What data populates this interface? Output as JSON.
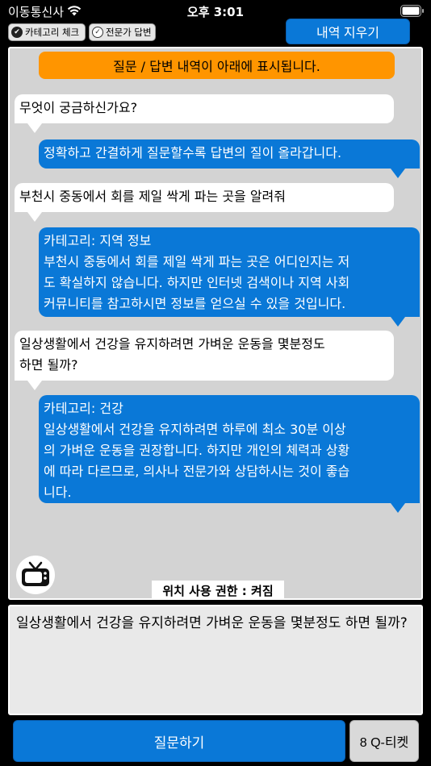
{
  "status_bar": {
    "carrier": "이동통신사",
    "time": "오후 3:01",
    "icons": [
      "wifi-icon",
      "battery-icon"
    ]
  },
  "toggles": {
    "category_check": {
      "label": "카테고리 체크",
      "checked": true
    },
    "expert_answer": {
      "label": "전문가 답변",
      "checked": false
    }
  },
  "clear_button": {
    "label": "내역 지우기"
  },
  "chat": {
    "banner": "질문 / 답변 내역이 아래에 표시됩니다.",
    "messages": [
      {
        "role": "user",
        "lines": [
          "무엇이 궁금하신가요?"
        ]
      },
      {
        "role": "bot",
        "lines": [
          "정확하고 간결하게 질문할수록 답변의 질이 올라갑니다."
        ]
      },
      {
        "role": "user",
        "lines": [
          "부천시 중동에서 회를 제일 싹게 파는 곳을 알려줘"
        ]
      },
      {
        "role": "bot",
        "lines": [
          "카테고리: 지역 정보",
          "부천시 중동에서 회를 제일 싹게 파는 곳은 어디인지는 저",
          "도 확실하지 않습니다. 하지만 인터넷 검색이나 지역 사회",
          "커뮤니티를 참고하시면 정보를 얻으실 수 있을 것입니다."
        ]
      },
      {
        "role": "user",
        "lines": [
          "일상생활에서 건강을 유지하려면 가벼운 운동을 몇분정도",
          "하면 될까?"
        ]
      },
      {
        "role": "bot",
        "lines": [
          "카테고리: 건강",
          "일상생활에서 건강을 유지하려면 하루에 최소 30분 이상",
          "의 가벼운 운동을 권장합니다. 하지만 개인의 체력과 상황",
          "에 따라 다르므로, 의사나 전문가와 상담하시는 것이 좋습",
          "니다."
        ]
      }
    ],
    "location_permission": "위치 사용 권한 : 켜짐",
    "avatar_icon": "tv-icon"
  },
  "input": {
    "value": "일상생활에서 건강을 유지하려면 가벼운 운동을 몇분정도 하면 될까?"
  },
  "ask_button": {
    "label": "질문하기"
  },
  "ticket_button": {
    "label": "8 Q-티켓"
  },
  "colors": {
    "accent_blue": "#0a78d7",
    "banner_orange": "#ff9500",
    "panel_gray": "#d3d3d3"
  }
}
